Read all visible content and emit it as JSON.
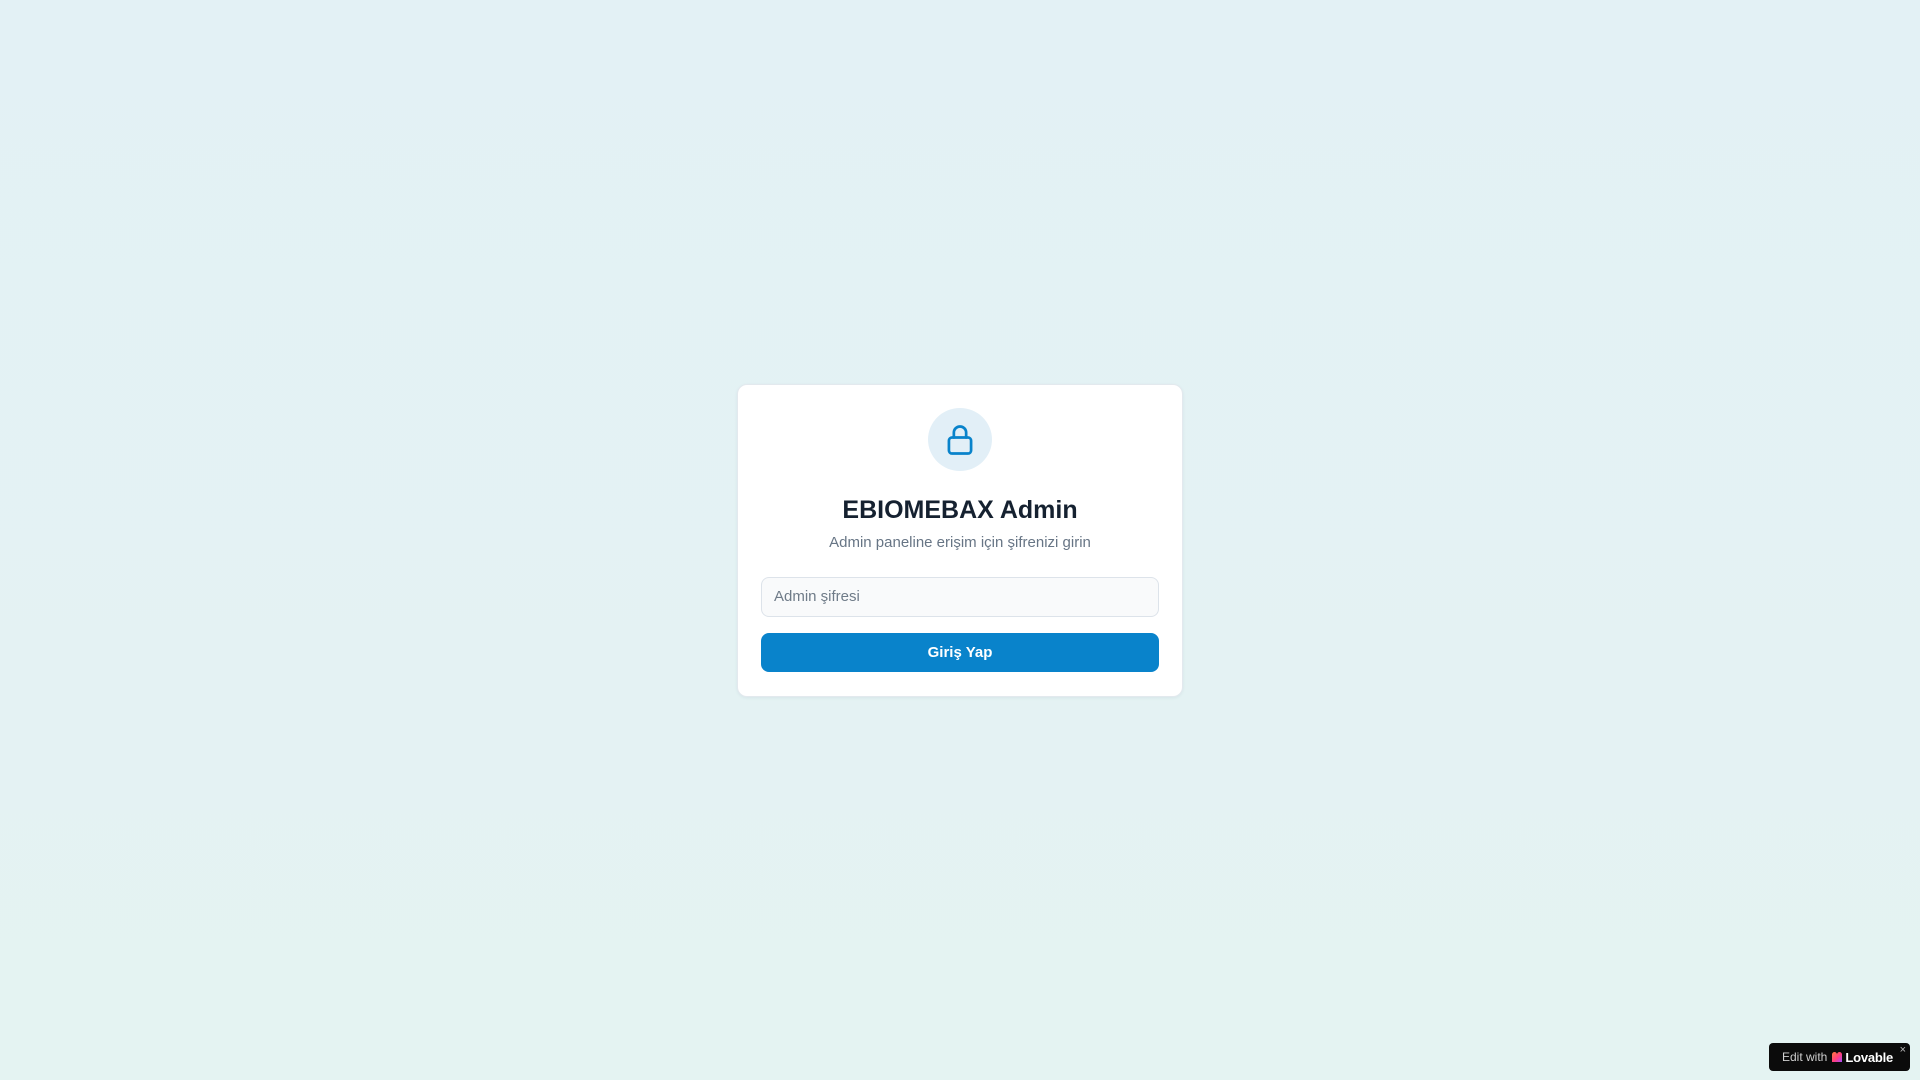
{
  "login": {
    "icon": "lock-icon",
    "title": "EBIOMEBAX Admin",
    "subtitle": "Admin paneline erişim için şifrenizi girin",
    "password_placeholder": "Admin şifresi",
    "password_value": "",
    "submit_label": "Giriş Yap"
  },
  "badge": {
    "edit_text": "Edit with",
    "brand_icon": "lovable-heart-icon",
    "brand": "Lovable",
    "close": "×"
  },
  "colors": {
    "accent": "#0983cb",
    "icon_background": "#e2eff7",
    "page_background": "#e3f1f5"
  }
}
